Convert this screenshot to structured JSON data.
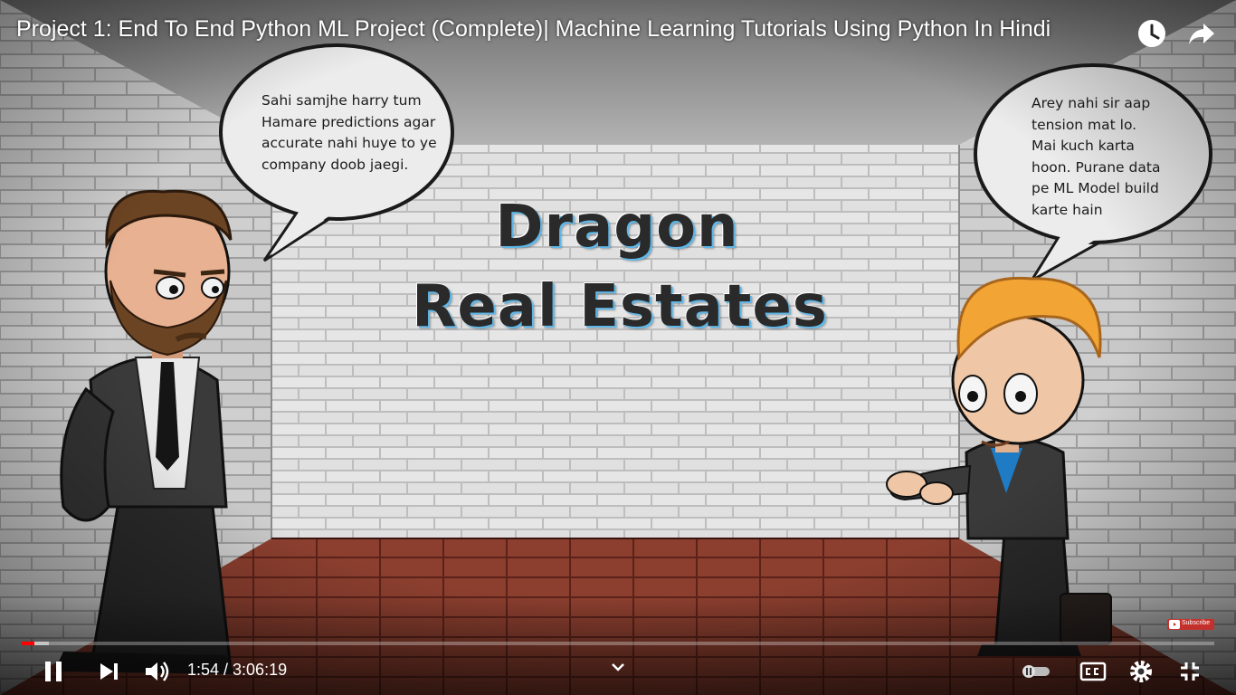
{
  "video": {
    "title": "Project 1: End To End Python ML Project (Complete)| Machine Learning Tutorials Using Python In Hindi",
    "progress": 0.0103,
    "buffered": 0.023
  },
  "scene": {
    "sign_line1": "Dragon",
    "sign_line2": "Real Estates",
    "left_bubble_lines": [
      "Sahi samjhe harry tum",
      "Hamare predictions agar",
      "accurate nahi huye to ye",
      "company doob jaegi."
    ],
    "right_bubble_lines": [
      "Arey nahi sir aap",
      "tension mat lo.",
      "Mai kuch karta",
      "hoon. Purane data",
      "pe ML Model build",
      "karte hain"
    ]
  },
  "controls": {
    "current_time": "1:54",
    "duration": "3:06:19",
    "time_display": "1:54 / 3:06:19",
    "subscribe_badge": "Subscribe"
  },
  "icons": {
    "watch_later": "clock-icon",
    "share": "share-icon",
    "pause": "pause-icon",
    "next": "next-icon",
    "volume": "volume-icon",
    "chevron": "chevron-down-icon",
    "autoplay": "autoplay-toggle",
    "captions": "cc-icon",
    "settings": "gear-icon",
    "exit_fullscreen": "exit-fullscreen-icon"
  },
  "colors": {
    "progress_played": "#ff0000",
    "sign_shadow": "#5fb7e8",
    "floor": "#8a3e2e",
    "brick": "#d9d9d9",
    "hair_left": "#6b4423",
    "hair_right": "#f2a535"
  }
}
